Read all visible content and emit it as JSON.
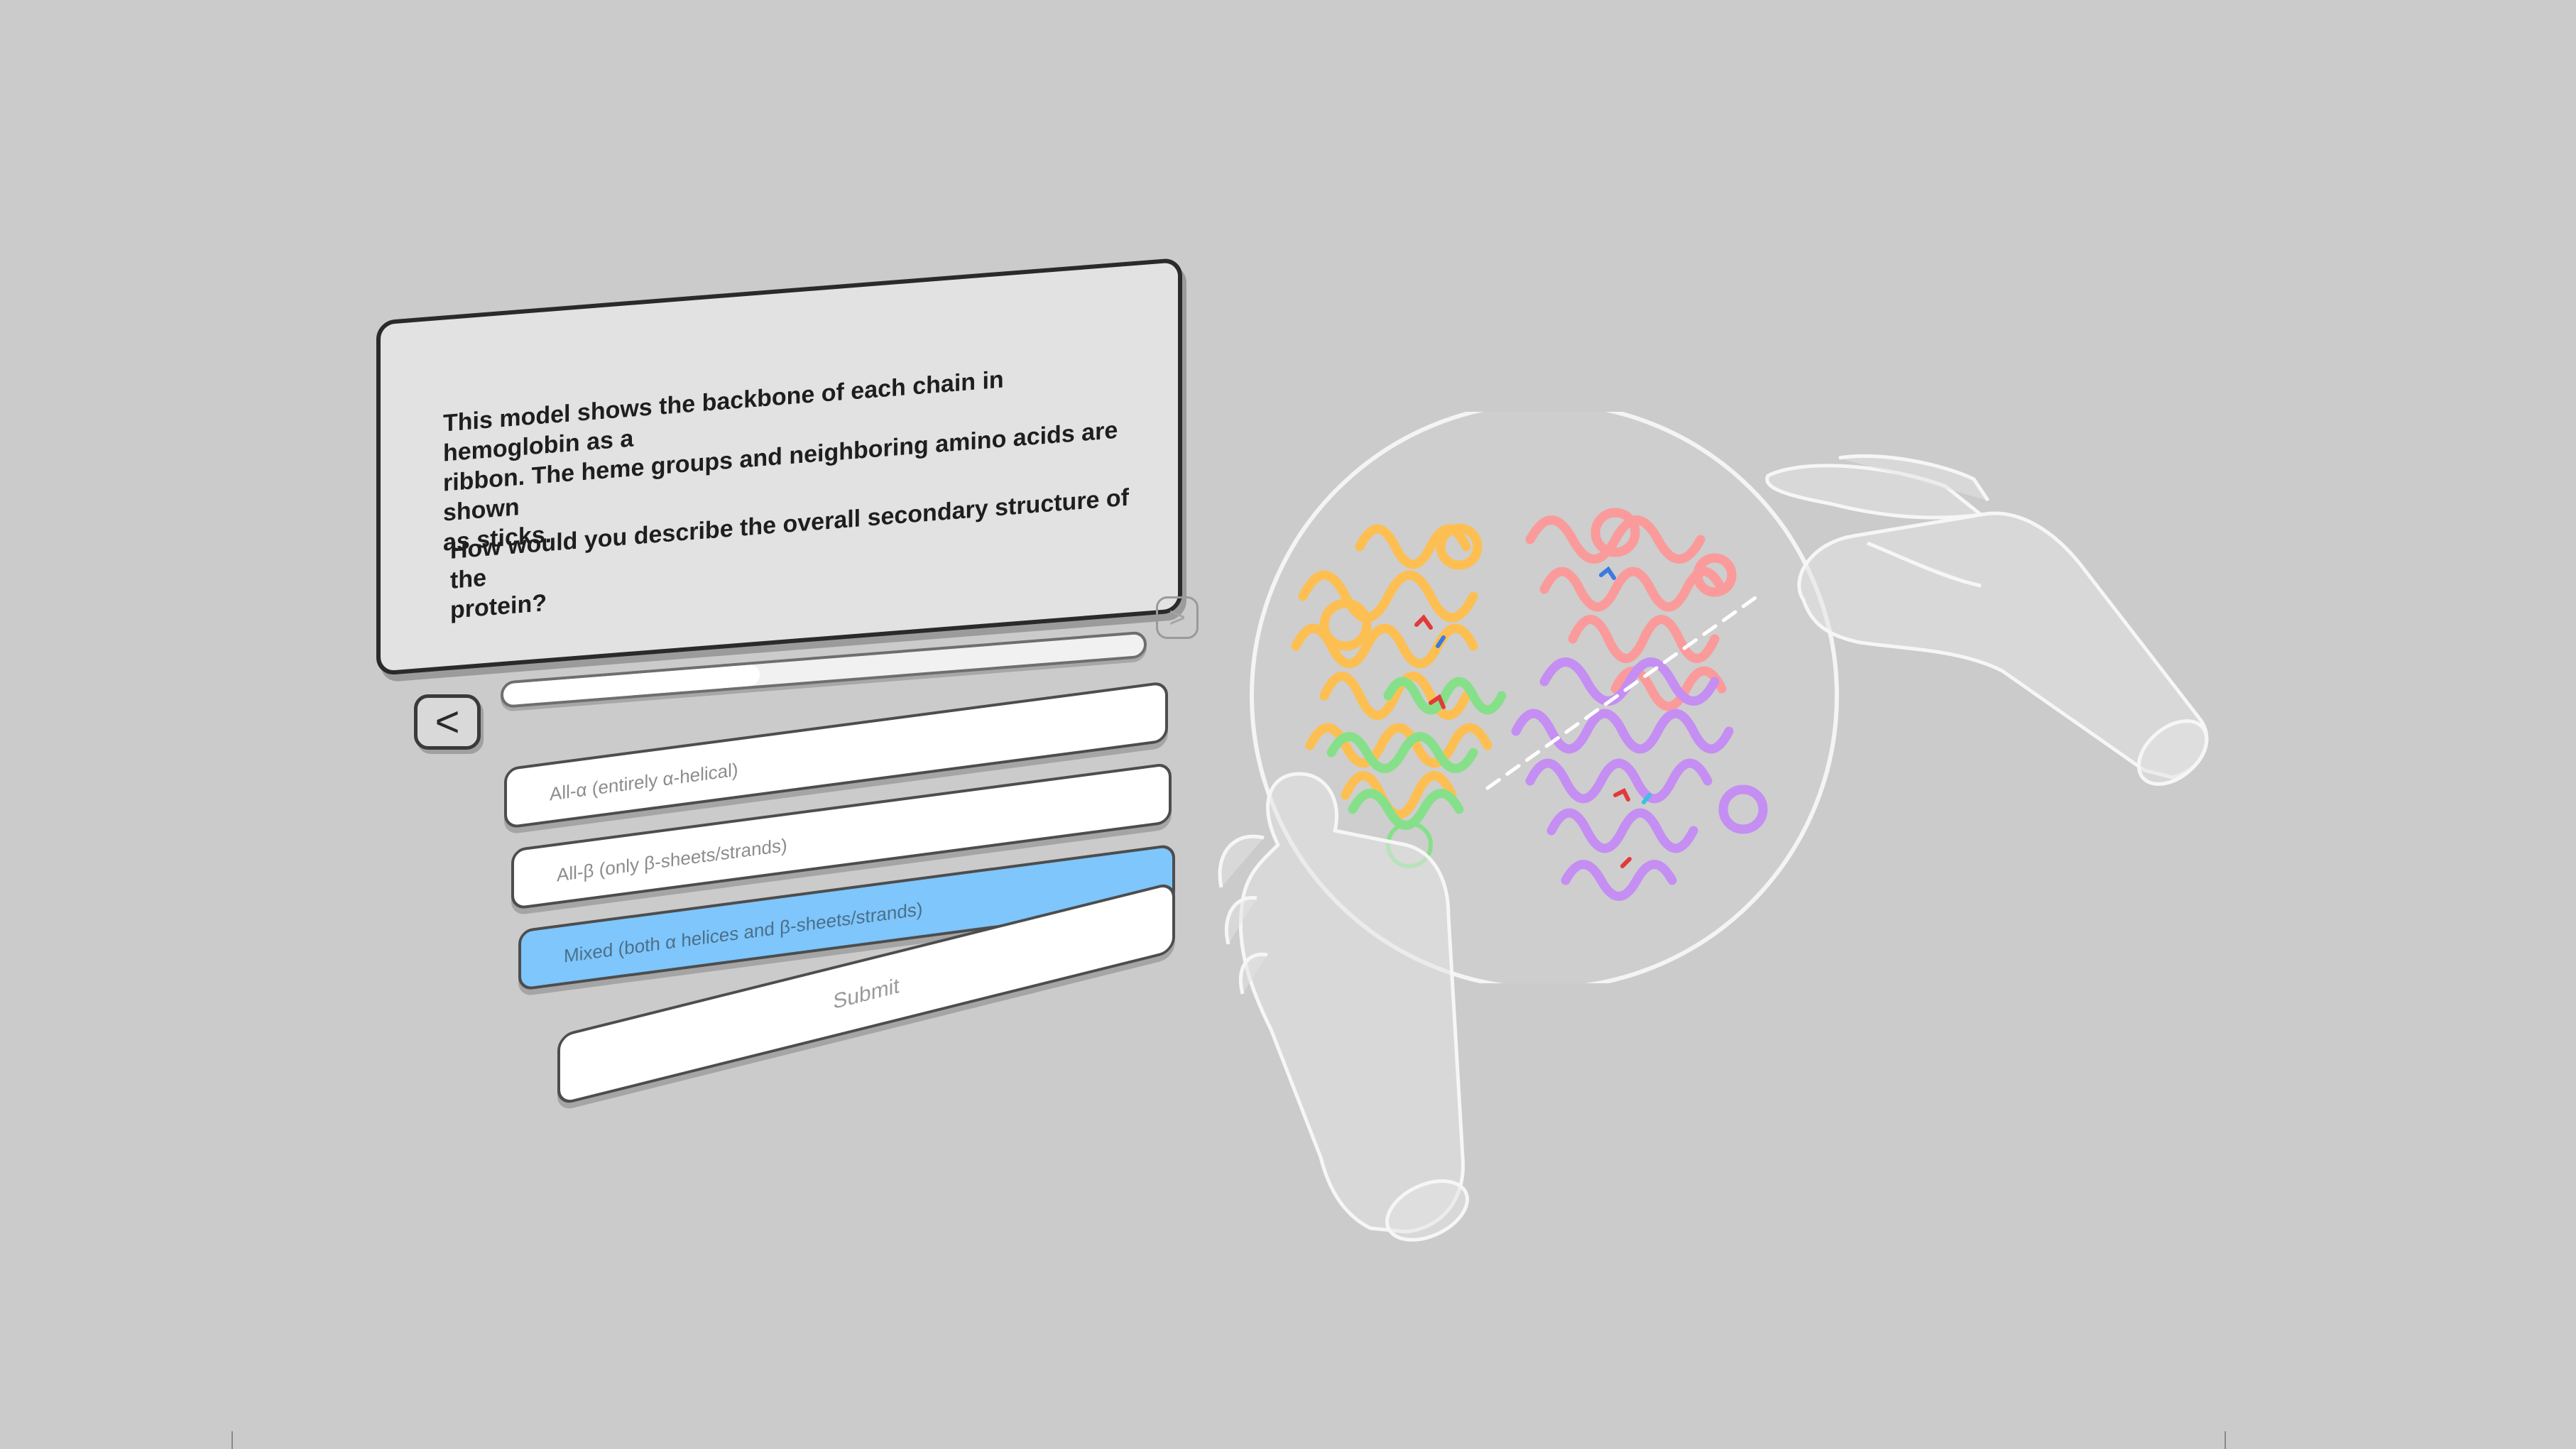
{
  "quiz": {
    "question_lines": [
      "This model shows the backbone of each chain in hemoglobin as a",
      "ribbon. The heme groups and neighboring amino acids are shown",
      "as sticks."
    ],
    "prompt_lines": [
      "How would you describe the overall secondary structure of the",
      "protein?"
    ],
    "progress": 0.4,
    "back_icon": "chevron-left-icon",
    "next_icon": "chevron-right-icon",
    "options": [
      {
        "label": "All-α (entirely α-helical)",
        "selected": false
      },
      {
        "label": "All-β (only β-sheets/strands)",
        "selected": false
      },
      {
        "label": "Mixed (both α helices and β-sheets/strands)",
        "selected": true
      }
    ],
    "submit_label": "Submit"
  },
  "colors": {
    "background": "#cbcbcb",
    "selected_option": "#7ec6fb",
    "chain_orange": "#fdbf52",
    "chain_red": "#fb9a9a",
    "chain_green": "#86e08a",
    "chain_purple": "#c58ef3"
  }
}
